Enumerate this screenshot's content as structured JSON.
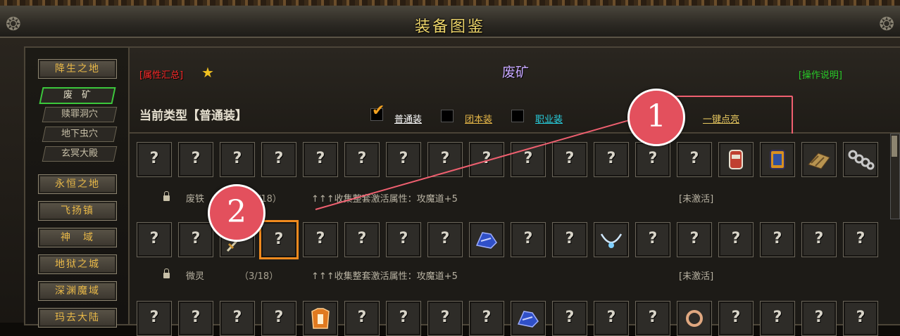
{
  "window": {
    "title": "装备图鉴"
  },
  "nav": {
    "groups": [
      {
        "label": "降生之地",
        "subs": [
          "废　矿",
          "赎罪洞穴",
          "地下虫穴",
          "玄冥大殿"
        ]
      },
      {
        "label": "永恒之地"
      },
      {
        "label": "飞扬镇"
      },
      {
        "label": "神　域"
      },
      {
        "label": "地狱之城"
      },
      {
        "label": "深渊魔域"
      },
      {
        "label": "玛去大陆"
      }
    ],
    "active_sub": "废　矿"
  },
  "header": {
    "attr_summary": "[属性汇总]",
    "star_icon": "star-icon",
    "map_title": "废矿",
    "help_link": "[操作说明]",
    "current_type_label": "当前类型【普通装】",
    "filters": [
      {
        "label": "普通装",
        "checked": true,
        "color": "#ffffff"
      },
      {
        "label": "团本装",
        "checked": false,
        "color": "#e8b848"
      },
      {
        "label": "职业装",
        "checked": false,
        "color": "#28d0e0"
      }
    ],
    "one_click": "一键点亮"
  },
  "rows": [
    {
      "name": "废铁",
      "progress": "（　/18）",
      "bonus": "↑↑↑收集整套激活属性：攻魔道+5",
      "status": "[未激活]"
    },
    {
      "name": "微灵",
      "progress": "（3/18）",
      "bonus": "↑↑↑收集整套激活属性：攻魔道+5",
      "status": "[未激活]"
    }
  ],
  "slot_placeholder": "?",
  "items": {
    "row1": [
      "?",
      "?",
      "?",
      "?",
      "?",
      "?",
      "?",
      "?",
      "?",
      "?",
      "?",
      "?",
      "?",
      "?",
      "jar-icon",
      "bucket-icon",
      "sandal-icon",
      "chain-icon"
    ],
    "row2": [
      "?",
      "?",
      "sword-icon",
      "?",
      "?",
      "?",
      "?",
      "?",
      "blue-boots-icon",
      "?",
      "?",
      "necklace-icon",
      "?",
      "?",
      "?",
      "?",
      "?",
      "?"
    ],
    "row3": [
      "?",
      "?",
      "?",
      "?",
      "orange-armor-icon",
      "?",
      "?",
      "?",
      "?",
      "blue-boots-icon",
      "?",
      "?",
      "?",
      "ring-icon",
      "?",
      "?",
      "?",
      "?"
    ]
  },
  "callouts": [
    "1",
    "2"
  ],
  "colors": {
    "title": "#ecd46a",
    "nav_text": "#e8b848",
    "active_border": "#3cc83c",
    "selected_border": "#f08a1e",
    "callout_bg": "#e3505d",
    "map_title": "#c8a8ff",
    "help": "#28c828",
    "attr": "#ff2a2a"
  }
}
